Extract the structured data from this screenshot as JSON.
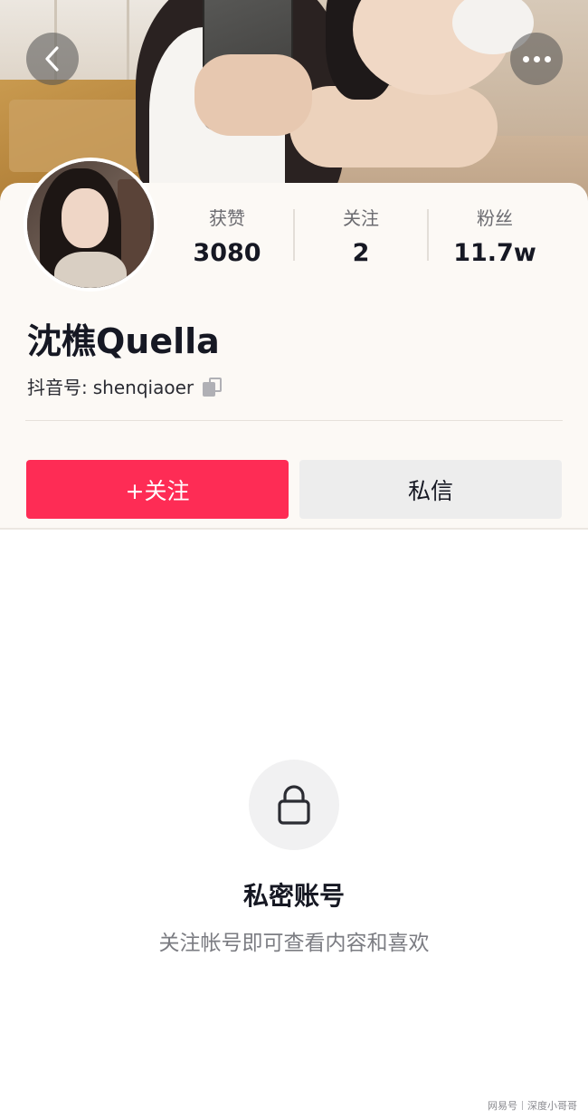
{
  "profile": {
    "display_name": "沈樵Quella",
    "douyin_id_label": "抖音号:",
    "douyin_id": "shenqiaoer"
  },
  "stats": [
    {
      "label": "获赞",
      "value": "3080"
    },
    {
      "label": "关注",
      "value": "2"
    },
    {
      "label": "粉丝",
      "value": "11.7w"
    }
  ],
  "actions": {
    "follow_label": "+关注",
    "message_label": "私信"
  },
  "private_notice": {
    "title": "私密账号",
    "subtitle": "关注帐号即可查看内容和喜欢"
  },
  "watermark": {
    "source": "网易号",
    "author": "深度小哥哥"
  },
  "icons": {
    "back": "chevron-left-icon",
    "more": "more-horizontal-icon",
    "copy": "copy-icon",
    "lock": "lock-icon"
  },
  "colors": {
    "follow_button": "#fe2c55",
    "message_button": "#ededed",
    "card_background": "#fcf9f5",
    "primary_text": "#161823",
    "secondary_text": "#7b7c82"
  }
}
